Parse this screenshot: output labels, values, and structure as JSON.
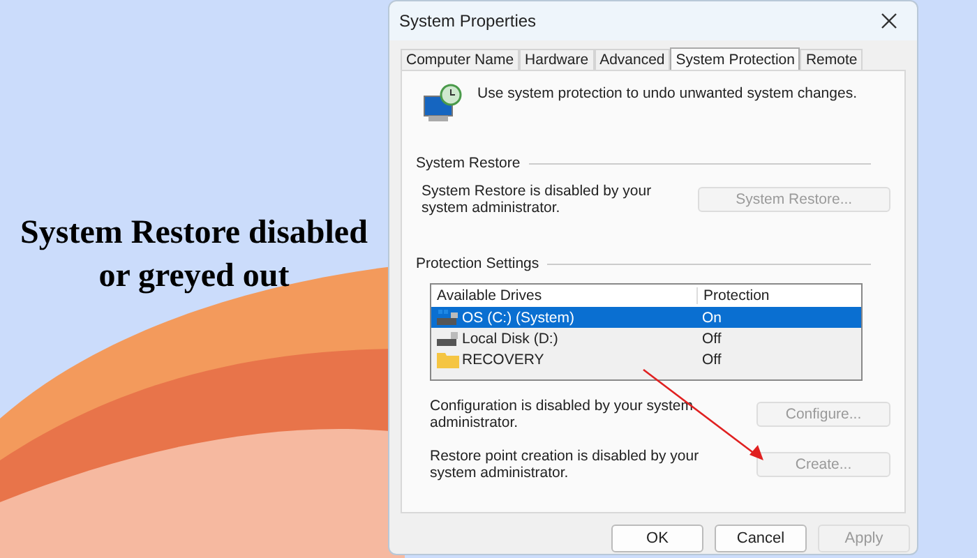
{
  "headline": [
    "System Restore disabled",
    "or greyed out"
  ],
  "window": {
    "title": "System Properties"
  },
  "tabs": [
    {
      "label": "Computer Name",
      "selected": false
    },
    {
      "label": "Hardware",
      "selected": false
    },
    {
      "label": "Advanced",
      "selected": false
    },
    {
      "label": "System Protection",
      "selected": true
    },
    {
      "label": "Remote",
      "selected": false
    }
  ],
  "description": "Use system protection to undo unwanted system changes.",
  "system_restore": {
    "heading": "System Restore",
    "message": "System Restore is disabled by your system administrator.",
    "button": {
      "label": "System Restore...",
      "disabled": true
    }
  },
  "protection_settings": {
    "heading": "Protection Settings",
    "columns": [
      "Available Drives",
      "Protection"
    ],
    "rows": [
      {
        "kind": "system",
        "drive": "OS (C:) (System)",
        "protection": "On",
        "selected": true
      },
      {
        "kind": "disk",
        "drive": "Local Disk (D:)",
        "protection": "Off",
        "selected": false
      },
      {
        "kind": "folder",
        "drive": "RECOVERY",
        "protection": "Off",
        "selected": false
      }
    ],
    "actions": [
      {
        "message": "Configuration is disabled by your system administrator.",
        "button": {
          "label": "Configure...",
          "disabled": true
        }
      },
      {
        "message": "Restore point creation is disabled by your system administrator.",
        "button": {
          "label": "Create...",
          "disabled": true
        }
      }
    ]
  },
  "buttons": [
    {
      "label": "OK",
      "disabled": false
    },
    {
      "label": "Cancel",
      "disabled": false
    },
    {
      "label": "Apply",
      "disabled": true
    }
  ]
}
